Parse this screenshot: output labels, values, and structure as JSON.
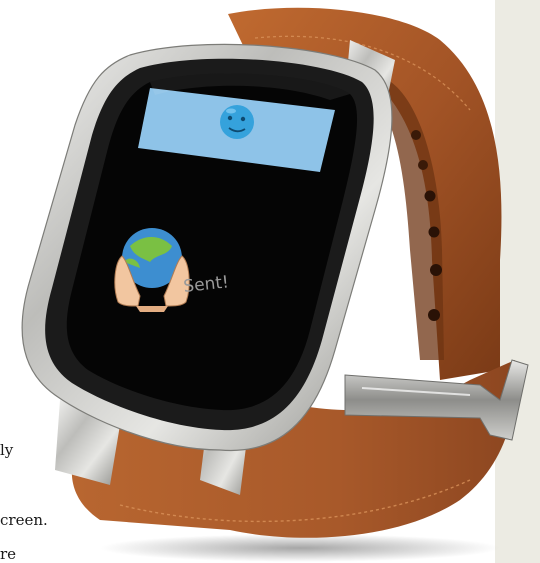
{
  "watch_screen": {
    "confirmation_text": "Sent!"
  },
  "page_text_fragments": [
    "ly",
    "creen.",
    "re"
  ],
  "colors": {
    "strap": "#a8592a",
    "strap_dark": "#6e3413",
    "case": "#c9c9c7",
    "screen": "#050505",
    "banner": "#8ec3e8",
    "emoji": "#35a2dc",
    "page_strip": "#ecebe3"
  },
  "icons": [
    "blue-face-emoji-icon",
    "earth-hands-icon"
  ]
}
